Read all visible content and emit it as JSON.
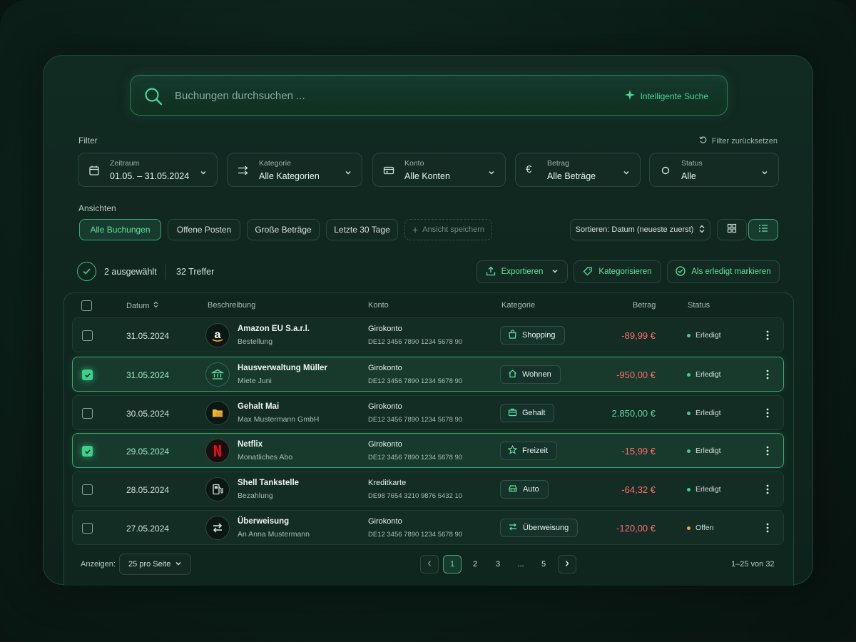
{
  "search": {
    "placeholder": "Buchungen durchsuchen ...",
    "smart_label": "Intelligente Suche"
  },
  "filter": {
    "title": "Filter",
    "reset": "Filter zurücksetzen",
    "items": [
      {
        "label": "Zeitraum",
        "value": "01.05. – 31.05.2024",
        "icon": "calendar-icon"
      },
      {
        "label": "Kategorie",
        "value": "Alle Kategorien",
        "icon": "shuffle-icon"
      },
      {
        "label": "Konto",
        "value": "Alle Konten",
        "icon": "card-icon"
      },
      {
        "label": "Betrag",
        "value": "Alle Beträge",
        "icon": "euro-icon"
      },
      {
        "label": "Status",
        "value": "Alle",
        "icon": "circle-icon"
      }
    ]
  },
  "views": {
    "title": "Ansichten",
    "items": [
      "Alle Buchungen",
      "Offene Posten",
      "Große Beträge",
      "Letzte 30 Tage"
    ],
    "save": "Ansicht speichern",
    "sort": "Sortieren: Datum (neueste zuerst)"
  },
  "selection": {
    "selected": "2 ausgewählt",
    "hits": "32 Treffer"
  },
  "actions": {
    "export": "Exportieren",
    "categorize": "Kategorisieren",
    "mark_done": "Als erledigt markieren"
  },
  "table": {
    "columns": {
      "date": "Datum",
      "description": "Beschreibung",
      "account": "Konto",
      "category": "Kategorie",
      "amount": "Betrag",
      "status": "Status"
    },
    "rows": [
      {
        "date": "31.05.2024",
        "title": "Amazon EU S.a.r.l.",
        "subtitle": "Bestellung",
        "account": "Girokonto",
        "iban": "DE12 3456 7890 1234 5678 90",
        "category": "Shopping",
        "amount": "-89,99 €",
        "status": "Erledigt",
        "selected": false,
        "logo": "amazon"
      },
      {
        "date": "31.05.2024",
        "title": "Hausverwaltung Müller",
        "subtitle": "Miete Juni",
        "account": "Girokonto",
        "iban": "DE12 3456 7890 1234 5678 90",
        "category": "Wohnen",
        "amount": "-950,00 €",
        "status": "Erledigt",
        "selected": true,
        "logo": "bank"
      },
      {
        "date": "30.05.2024",
        "title": "Gehalt Mai",
        "subtitle": "Max Mustermann GmbH",
        "account": "Girokonto",
        "iban": "DE12 3456 7890 1234 5678 90",
        "category": "Gehalt",
        "amount": "2.850,00 €",
        "status": "Erledigt",
        "selected": false,
        "logo": "folder"
      },
      {
        "date": "29.05.2024",
        "title": "Netflix",
        "subtitle": "Monatliches Abo",
        "account": "Girokonto",
        "iban": "DE12 3456 7890 1234 5678 90",
        "category": "Freizeit",
        "amount": "-15,99 €",
        "status": "Erledigt",
        "selected": true,
        "logo": "netflix"
      },
      {
        "date": "28.05.2024",
        "title": "Shell Tankstelle",
        "subtitle": "Bezahlung",
        "account": "Kreditkarte",
        "iban": "DE98 7654 3210 9876 5432 10",
        "category": "Auto",
        "amount": "-64,32 €",
        "status": "Erledigt",
        "selected": false,
        "logo": "fuel"
      },
      {
        "date": "27.05.2024",
        "title": "Überweisung",
        "subtitle": "An Anna Mustermann",
        "account": "Girokonto",
        "iban": "DE12 3456 7890 1234 5678 90",
        "category": "Überweisung",
        "amount": "-120,00 €",
        "status": "Offen",
        "selected": false,
        "logo": "transfer"
      }
    ]
  },
  "pagination": {
    "show_label": "Anzeigen:",
    "per_page": "25 pro Seite",
    "pages": [
      "1",
      "2",
      "3",
      "...",
      "5"
    ],
    "range": "1–25 von 32"
  },
  "colors": {
    "accent": "#3ad28a",
    "negative": "#ff6b6b",
    "positive": "#59d99a",
    "done": "#3ad28a",
    "open": "#f0a53a"
  }
}
